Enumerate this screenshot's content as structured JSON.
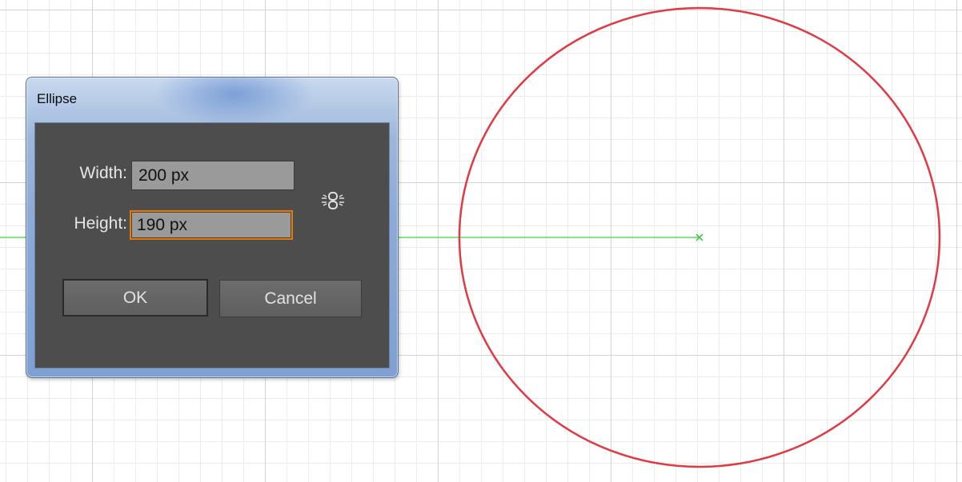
{
  "dialog": {
    "title": "Ellipse",
    "width_label": "Width:",
    "width_value": "200 px",
    "height_label": "Height:",
    "height_value": "190 px",
    "ok_label": "OK",
    "cancel_label": "Cancel",
    "constrain_icon": "link-constrain-proportions"
  },
  "artboard": {
    "shape": "ellipse",
    "stroke_color": "#e03a45",
    "guide_color": "#5ddc5d",
    "center_marker_color": "#3cc43c"
  }
}
